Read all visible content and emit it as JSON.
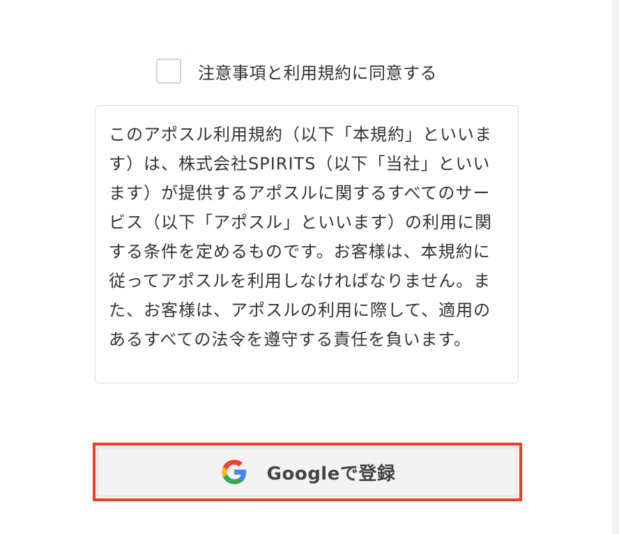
{
  "agreement": {
    "checkbox_checked": false,
    "label": "注意事項と利用規約に同意する"
  },
  "terms": {
    "text": "このアポスル利用規約（以下「本規約」といいます）は、株式会社SPIRITS（以下「当社」といいます）が提供するアポスルに関するすべてのサービス（以下「アポスル」といいます）の利用に関する条件を定めるものです。お客様は、本規約に従ってアポスルを利用しなければなりません。また、お客様は、アポスルの利用に際して、適用のあるすべての法令を遵守する責任を負います。"
  },
  "google_button": {
    "label": "Googleで登録",
    "icon": "google-g-icon",
    "highlight_color": "#e5412a"
  },
  "colors": {
    "text": "#333333",
    "border": "#d3dce3",
    "button_bg": "#f3f3f3",
    "highlight": "#e5412a"
  }
}
